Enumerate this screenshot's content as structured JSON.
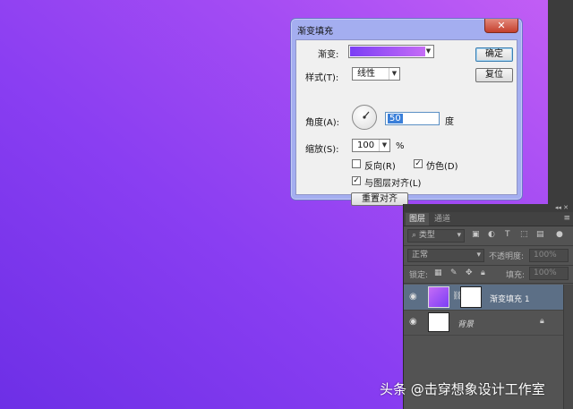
{
  "dialog": {
    "title": "渐变填充",
    "close_label": "✕",
    "gradient_label": "渐变:",
    "style_label": "样式(T):",
    "style_value": "线性",
    "angle_label": "角度(A):",
    "angle_value": "50",
    "angle_unit": "度",
    "scale_label": "缩放(S):",
    "scale_value": "100",
    "scale_unit": "%",
    "reverse_label": "反向(R)",
    "reverse_checked": false,
    "dither_label": "仿色(D)",
    "dither_checked": true,
    "align_label": "与图层对齐(L)",
    "align_checked": true,
    "reset_align_label": "重置对齐",
    "ok_label": "确定",
    "reset_label": "复位",
    "gradient_colors": [
      "#7b3ef5",
      "#c56cf6"
    ]
  },
  "layers_panel": {
    "collapse_icons": "◂◂ ✕",
    "tabs": [
      "图层",
      "通道"
    ],
    "active_tab": "图层",
    "menu_icon": "≡",
    "filter_kind": "类型",
    "blend_mode": "正常",
    "opacity_label": "不透明度:",
    "opacity_value": "100%",
    "lock_label": "锁定:",
    "fill_label": "填充:",
    "fill_value": "100%",
    "layers": [
      {
        "name": "渐变填充 1",
        "selected": true
      },
      {
        "name": "背景",
        "locked": true
      }
    ]
  },
  "watermark": "头条 @击穿想象设计工作室",
  "colors": {
    "background_gradient": [
      "#c45ff5",
      "#6d2fe6"
    ],
    "selection": "#5c6f86",
    "panel": "#535353"
  }
}
